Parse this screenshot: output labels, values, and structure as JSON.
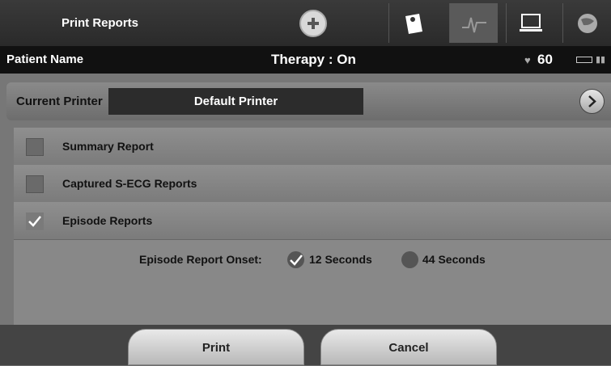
{
  "header": {
    "title": "Print Reports",
    "add_icon": "add-circle-icon",
    "tool_icons": [
      "program-card-icon",
      "waveform-icon",
      "computer-monitor-icon",
      "globe-icon"
    ]
  },
  "status": {
    "patient_label": "Patient Name",
    "therapy": "Therapy : On",
    "heart_rate": "60",
    "heart_icon": "heart-icon",
    "battery_icon": "battery-icon",
    "signal_icon": "signal-icon"
  },
  "printer": {
    "label": "Current Printer",
    "value": "Default Printer",
    "arrow_icon": "chevron-right-icon"
  },
  "reports": [
    {
      "label": "Summary Report",
      "checked": false
    },
    {
      "label": "Captured S-ECG Reports",
      "checked": false
    },
    {
      "label": "Episode Reports",
      "checked": true
    }
  ],
  "onset": {
    "label": "Episode Report Onset:",
    "options": [
      {
        "label": "12 Seconds",
        "selected": true
      },
      {
        "label": "44 Seconds",
        "selected": false
      }
    ]
  },
  "buttons": {
    "print": "Print",
    "cancel": "Cancel"
  }
}
